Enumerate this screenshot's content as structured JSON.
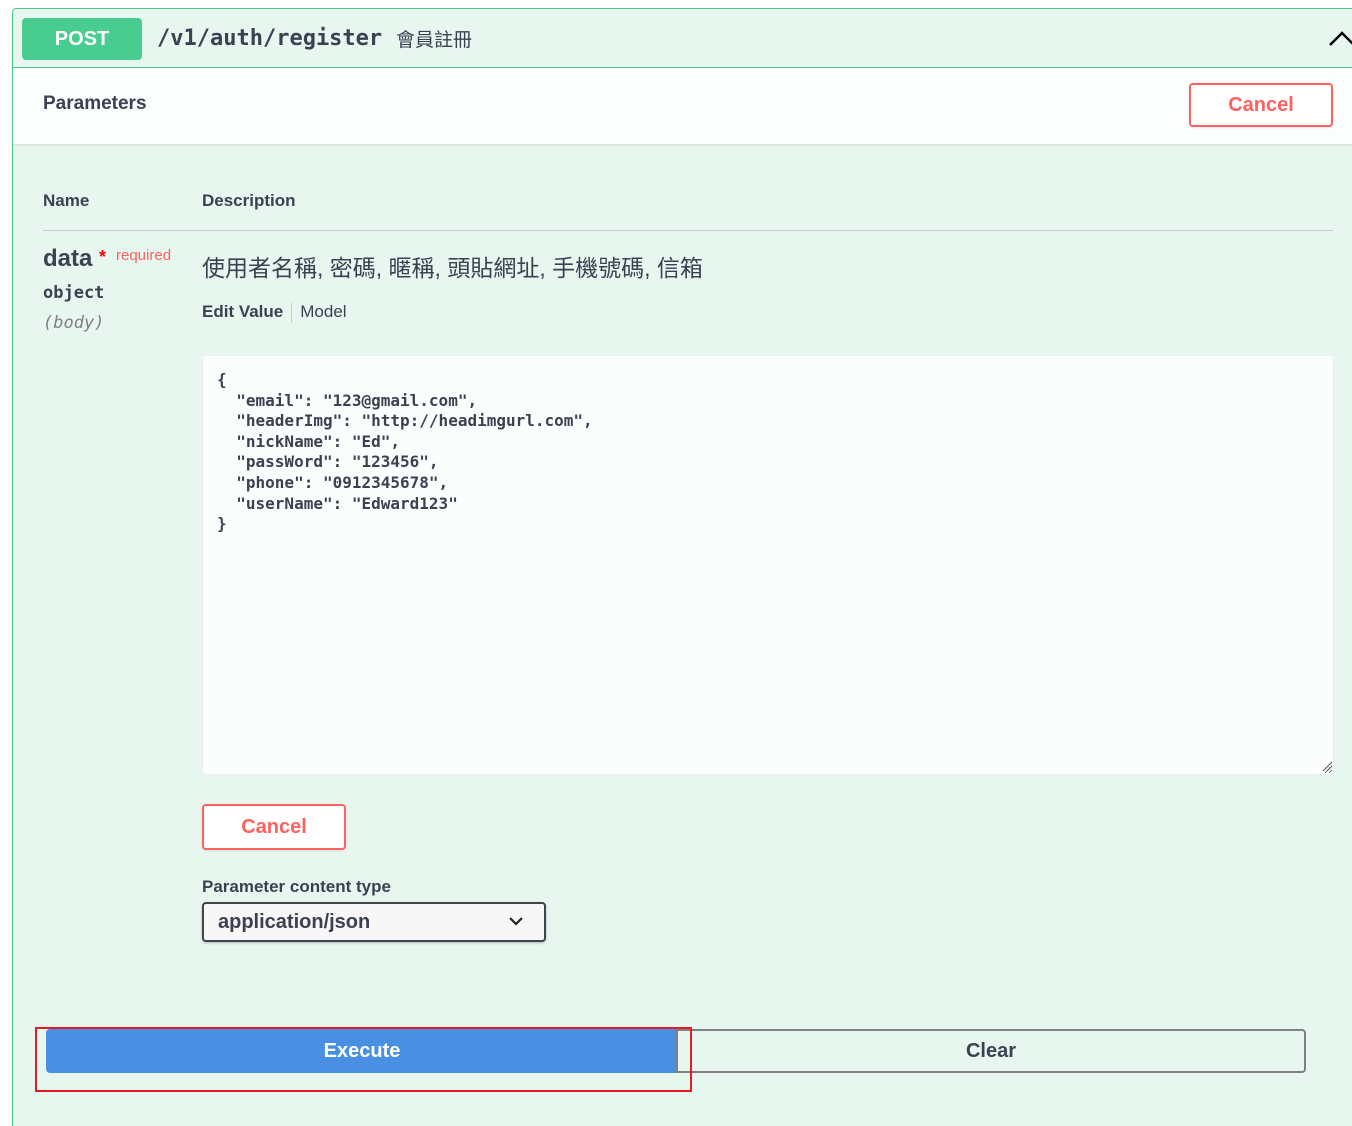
{
  "summary": {
    "method": "POST",
    "path": "/v1/auth/register",
    "description": "會員註冊"
  },
  "parameters_section": {
    "title": "Parameters",
    "cancel_label": "Cancel"
  },
  "table_header": {
    "name": "Name",
    "description": "Description"
  },
  "parameter": {
    "name": "data",
    "required_star": "*",
    "required_label": "required",
    "type": "object",
    "in": "(body)",
    "description": "使用者名稱, 密碼, 暱稱, 頭貼網址, 手機號碼, 信箱",
    "tabs": {
      "edit_value": "Edit Value",
      "model": "Model"
    },
    "edit_value": "{\n  \"email\": \"123@gmail.com\",\n  \"headerImg\": \"http://headimgurl.com\",\n  \"nickName\": \"Ed\",\n  \"passWord\": \"123456\",\n  \"phone\": \"0912345678\",\n  \"userName\": \"Edward123\"\n}",
    "cancel_label": "Cancel"
  },
  "content_type": {
    "label": "Parameter content type",
    "selected": "application/json"
  },
  "actions": {
    "execute_label": "Execute",
    "clear_label": "Clear"
  },
  "colors": {
    "post_green": "#49cc90",
    "cancel_red": "#ff6060",
    "execute_blue": "#4990e2",
    "highlight_red": "#e31b23"
  },
  "icons": {
    "collapse": "chevron-up-icon",
    "select": "chevron-down-icon"
  }
}
